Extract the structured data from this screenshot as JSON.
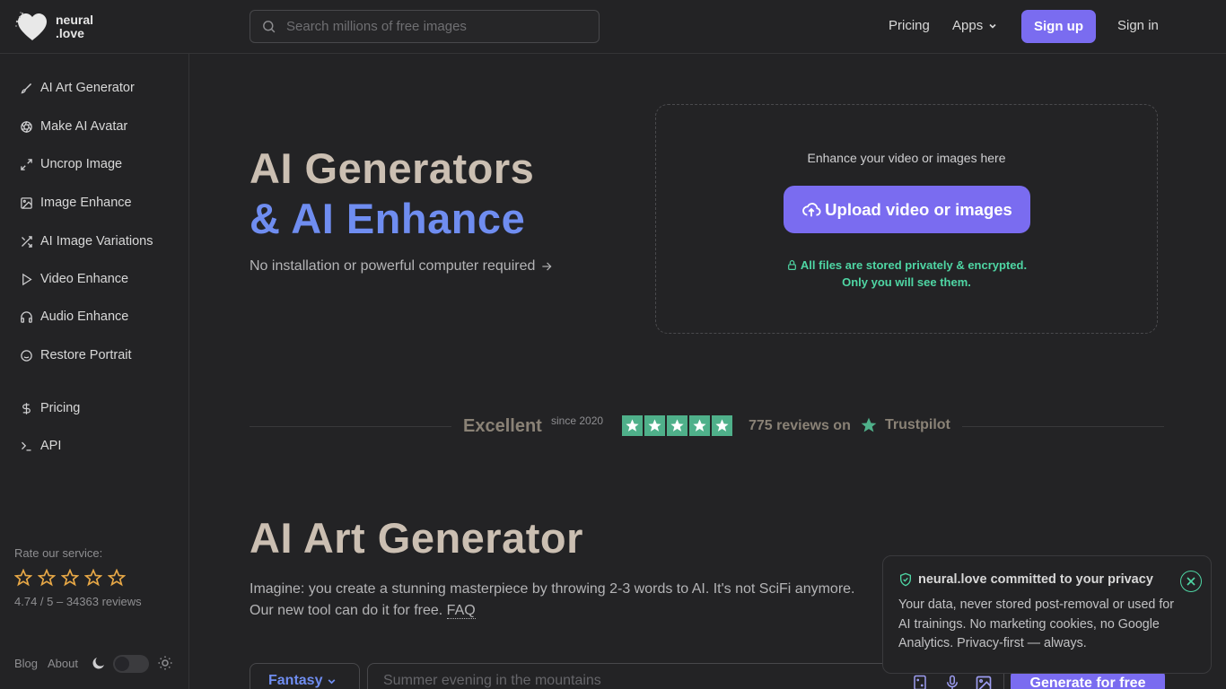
{
  "header": {
    "logo_line1": "neural",
    "logo_line2": ".love",
    "search_placeholder": "Search millions of free images",
    "nav_pricing": "Pricing",
    "nav_apps": "Apps",
    "signup": "Sign up",
    "signin": "Sign in"
  },
  "sidebar": {
    "items": [
      {
        "label": "AI Art Generator",
        "icon": "brush-icon"
      },
      {
        "label": "Make AI Avatar",
        "icon": "aperture-icon"
      },
      {
        "label": "Uncrop Image",
        "icon": "expand-icon"
      },
      {
        "label": "Image Enhance",
        "icon": "image-icon"
      },
      {
        "label": "AI Image Variations",
        "icon": "shuffle-icon"
      },
      {
        "label": "Video Enhance",
        "icon": "play-icon"
      },
      {
        "label": "Audio Enhance",
        "icon": "headphones-icon"
      },
      {
        "label": "Restore Portrait",
        "icon": "smile-icon"
      },
      {
        "label": "Pricing",
        "icon": "dollar-icon"
      },
      {
        "label": "API",
        "icon": "terminal-icon"
      }
    ],
    "rate_label": "Rate our service:",
    "rate_score": "4.74 / 5 – 34363 reviews",
    "footer_blog": "Blog",
    "footer_about": "About"
  },
  "hero": {
    "line1": "AI Generators",
    "line2": "& AI Enhance",
    "subtitle": "No installation or powerful computer required"
  },
  "upload": {
    "hint": "Enhance your video or images here",
    "button": "Upload video or images",
    "privacy_line1": "All files are stored privately & encrypted.",
    "privacy_line2": "Only you will see them."
  },
  "trustpilot": {
    "rating_word": "Excellent",
    "since": "since 2020",
    "stars": 5,
    "reviews": "775 reviews on",
    "brand": "Trustpilot"
  },
  "art_generator": {
    "title": "AI Art Generator",
    "desc_line1": "Imagine: you create a stunning masterpiece by throwing 2-3 words to AI. It's not SciFi anymore.",
    "desc_line2": "Our new tool can do it for free.",
    "faq": "FAQ",
    "style": "Fantasy",
    "prompt_placeholder": "Summer evening in the mountains",
    "generate": "Generate for free"
  },
  "privacy_popup": {
    "title": "neural.love committed to your privacy",
    "body": "Your data, never stored post-removal or used for AI trainings. No marketing cookies, no Google Analytics. Privacy-first — always."
  },
  "colors": {
    "background": "#232325",
    "accent": "#7a6cf0",
    "hero_blue": "#6f8df0",
    "hero_beige": "#cbbfb2",
    "success_green": "#4fd6a4",
    "trustpilot_green": "#4fb08a"
  }
}
